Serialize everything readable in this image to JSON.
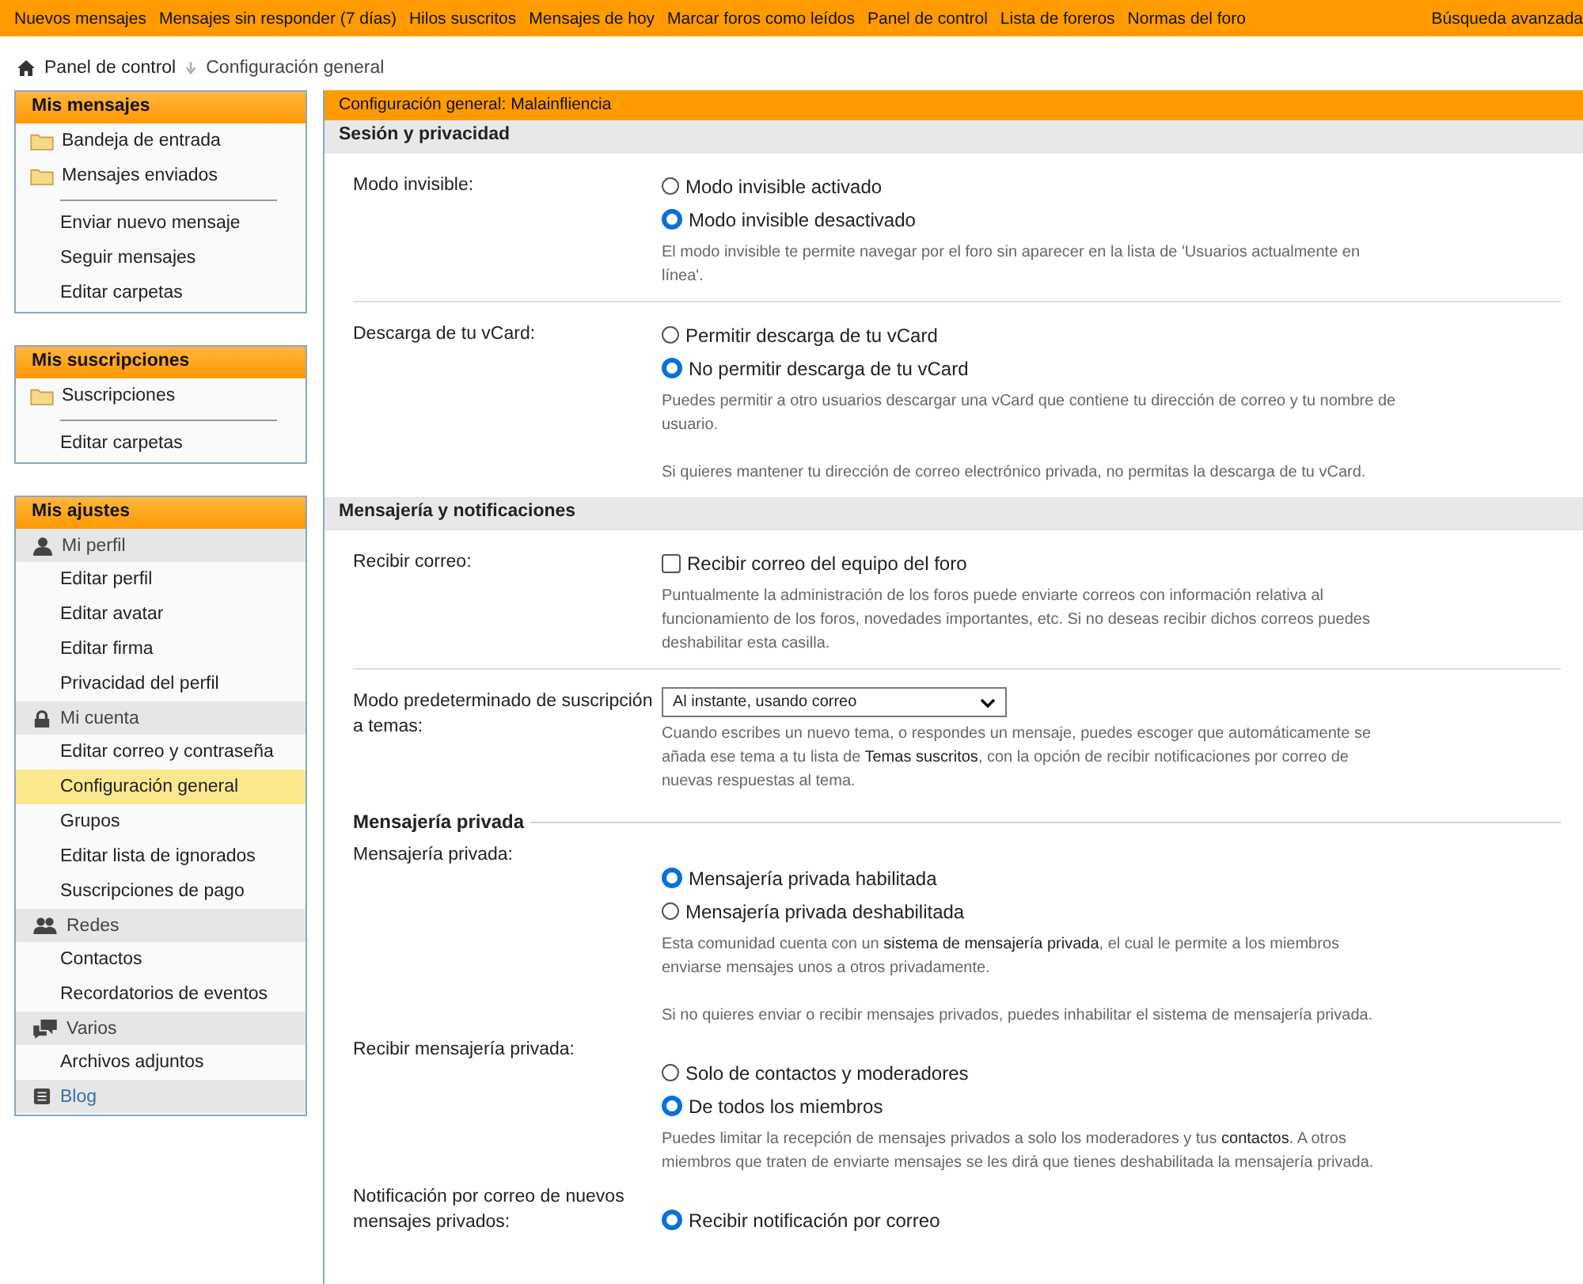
{
  "nav_links": [
    "Nuevos mensajes",
    "Mensajes sin responder (7 días)",
    "Hilos suscritos",
    "Mensajes de hoy",
    "Marcar foros como leídos",
    "Panel de control",
    "Lista de foreros",
    "Normas del foro"
  ],
  "advanced_search": "Búsqueda avanzada",
  "breadcrumb": [
    "Panel de control",
    "Configuración general"
  ],
  "sidebar": [
    {
      "title": "Mis mensajes",
      "items": [
        {
          "kind": "folder",
          "label": "Bandeja de entrada"
        },
        {
          "kind": "folder",
          "label": "Mensajes enviados"
        },
        {
          "kind": "divider"
        },
        {
          "kind": "link",
          "label": "Enviar nuevo mensaje",
          "selected": false
        },
        {
          "kind": "link",
          "label": "Seguir mensajes",
          "selected": false
        },
        {
          "kind": "link",
          "label": "Editar carpetas",
          "selected": false
        }
      ]
    },
    {
      "title": "Mis suscripciones",
      "items": [
        {
          "kind": "folder",
          "label": "Suscripciones"
        },
        {
          "kind": "divider"
        },
        {
          "kind": "link",
          "label": "Editar carpetas",
          "selected": false
        }
      ]
    },
    {
      "title": "Mis ajustes",
      "groups": [
        {
          "label": "Mi perfil",
          "children": [
            {
              "label": "Editar perfil",
              "selected": false
            },
            {
              "label": "Editar avatar",
              "selected": false
            },
            {
              "label": "Editar firma",
              "selected": false
            },
            {
              "label": "Privacidad del perfil",
              "selected": false
            }
          ]
        },
        {
          "label": "Mi cuenta",
          "children": [
            {
              "label": "Editar correo y contraseña",
              "selected": false
            },
            {
              "label": "Configuración general",
              "selected": true
            },
            {
              "label": "Grupos",
              "selected": false
            },
            {
              "label": "Editar lista de ignorados",
              "selected": false
            },
            {
              "label": "Suscripciones de pago",
              "selected": false
            }
          ]
        },
        {
          "label": "Redes",
          "children": [
            {
              "label": "Contactos",
              "selected": false
            },
            {
              "label": "Recordatorios de eventos",
              "selected": false
            }
          ]
        },
        {
          "label": "Varios",
          "children": [
            {
              "label": "Archivos adjuntos",
              "selected": false
            }
          ]
        },
        {
          "label": "Blog"
        }
      ]
    }
  ],
  "panel_title": "Configuración general: Malainfliencia",
  "sections": [
    {
      "kind": "bar",
      "title": "Sesión y privacidad",
      "rows": [
        {
          "label": "Modo invisible:",
          "kind": "radio",
          "options": [
            {
              "label": "Modo invisible activado",
              "selected": false
            },
            {
              "label": "Modo invisible desactivado",
              "selected": true
            }
          ],
          "notes": [
            "El modo invisible te permite navegar por el foro sin aparecer en la lista de 'Usuarios actualmente en línea'."
          ]
        },
        {
          "label": "Descarga de tu vCard:",
          "kind": "radio",
          "options": [
            {
              "label": "Permitir descarga de tu vCard",
              "selected": false
            },
            {
              "label": "No permitir descarga de tu vCard",
              "selected": true
            }
          ],
          "notes": [
            "Puedes permitir a otro usuarios descargar una vCard que contiene tu dirección de correo y tu nombre de usuario.",
            "Si quieres mantener tu dirección de correo electrónico privada, no permitas la descarga de tu vCard."
          ]
        }
      ]
    },
    {
      "kind": "bar",
      "title": "Mensajería y notificaciones",
      "rows": [
        {
          "label": "Recibir correo:",
          "kind": "checkbox",
          "options": [
            {
              "label": "Recibir correo del equipo del foro",
              "checked": false
            }
          ],
          "notes": [
            "Puntualmente la administración de los foros puede enviarte correos con información relativa al funcionamiento de los foros, novedades importantes, etc. Si no deseas recibir dichos correos puedes deshabilitar esta casilla."
          ]
        },
        {
          "label": "Modo predeterminado de suscripción a temas:",
          "kind": "select",
          "value": "Al instante, usando correo",
          "notes": [
            "Cuando escribes un nuevo tema, o respondes un mensaje, puedes escoger que automáticamente se añada ese tema a tu lista de **Temas suscritos**, con la opción de recibir notificaciones por correo de nuevas respuestas al tema."
          ]
        }
      ]
    },
    {
      "kind": "legend",
      "title": "Mensajería privada",
      "rows": [
        {
          "label": "Mensajería privada:",
          "kind": "radio",
          "options": [
            {
              "label": "Mensajería privada habilitada",
              "selected": true
            },
            {
              "label": "Mensajería privada deshabilitada",
              "selected": false
            }
          ],
          "notes": [
            "Esta comunidad cuenta con un **sistema de mensajería privada**, el cual le permite a los miembros enviarse mensajes unos a otros privadamente.",
            "Si no quieres enviar o recibir mensajes privados, puedes inhabilitar el sistema de mensajería privada."
          ]
        },
        {
          "label": "Recibir mensajería privada:",
          "kind": "radio",
          "options": [
            {
              "label": "Solo de contactos y moderadores",
              "selected": false
            },
            {
              "label": "De todos los miembros",
              "selected": true
            }
          ],
          "notes": [
            "Puedes limitar la recepción de mensajes privados a solo los moderadores y tus **contactos**. A otros miembros que traten de enviarte mensajes se les dirá que tienes deshabilitada la mensajería privada."
          ]
        },
        {
          "label": "Notificación por correo de nuevos mensajes privados:",
          "kind": "radio",
          "options": [
            {
              "label": "Recibir notificación por correo",
              "selected": true
            }
          ]
        }
      ]
    }
  ]
}
